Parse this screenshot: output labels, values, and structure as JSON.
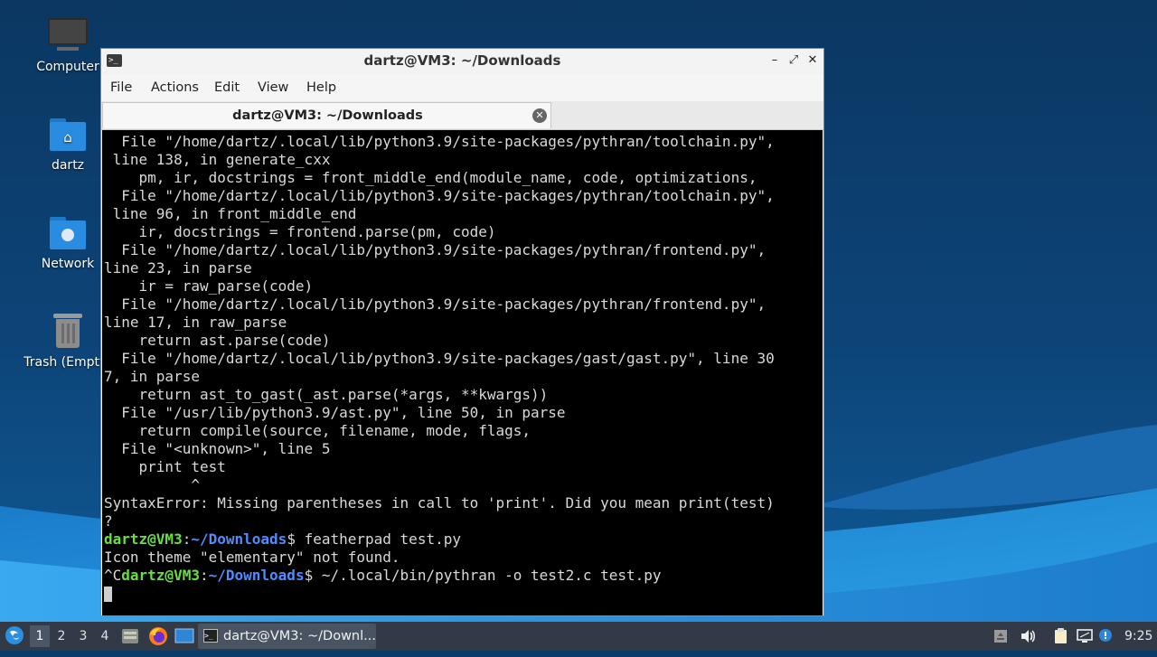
{
  "desktop": {
    "icons": [
      {
        "label": "Computer",
        "icon": "computer-icon"
      },
      {
        "label": "dartz",
        "icon": "home-folder-icon"
      },
      {
        "label": "Network",
        "icon": "network-folder-icon"
      },
      {
        "label": "Trash (Empty)",
        "icon": "trash-icon"
      }
    ]
  },
  "window": {
    "title": "dartz@VM3: ~/Downloads",
    "menu": [
      "File",
      "Actions",
      "Edit",
      "View",
      "Help"
    ],
    "tab_label": "dartz@VM3: ~/Downloads"
  },
  "terminal": {
    "lines": [
      "  File \"/home/dartz/.local/lib/python3.9/site-packages/pythran/toolchain.py\",",
      " line 138, in generate_cxx",
      "    pm, ir, docstrings = front_middle_end(module_name, code, optimizations,",
      "  File \"/home/dartz/.local/lib/python3.9/site-packages/pythran/toolchain.py\",",
      " line 96, in front_middle_end",
      "    ir, docstrings = frontend.parse(pm, code)",
      "  File \"/home/dartz/.local/lib/python3.9/site-packages/pythran/frontend.py\",",
      "line 23, in parse",
      "    ir = raw_parse(code)",
      "  File \"/home/dartz/.local/lib/python3.9/site-packages/pythran/frontend.py\",",
      "line 17, in raw_parse",
      "    return ast.parse(code)",
      "  File \"/home/dartz/.local/lib/python3.9/site-packages/gast/gast.py\", line 30",
      "7, in parse",
      "    return ast_to_gast(_ast.parse(*args, **kwargs))",
      "  File \"/usr/lib/python3.9/ast.py\", line 50, in parse",
      "    return compile(source, filename, mode, flags,",
      "  File \"<unknown>\", line 5",
      "    print test",
      "          ^",
      "SyntaxError: Missing parentheses in call to 'print'. Did you mean print(test)",
      "?"
    ],
    "prompt_user": "dartz@VM3",
    "prompt_colon": ":",
    "prompt_path": "~/Downloads",
    "prompt_dollar": "$",
    "cmd1": " featherpad test.py",
    "output1": "Icon theme \"elementary\" not found.",
    "ctrl_c": "^C",
    "cmd2": " ~/.local/bin/pythran -o test2.c test.py"
  },
  "taskbar": {
    "workspaces": [
      "1",
      "2",
      "3",
      "4"
    ],
    "active_workspace": "1",
    "task_label": "dartz@VM3: ~/Downl...",
    "clock": "9:25"
  },
  "colors": {
    "prompt_user": "#67e03e",
    "prompt_path": "#4d8dff",
    "terminal_bg": "#000000",
    "taskbar_bg": "#313a46"
  }
}
